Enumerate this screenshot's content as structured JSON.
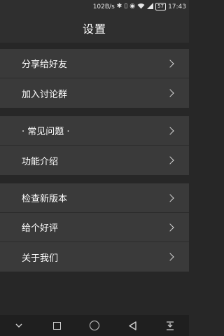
{
  "statusbar": {
    "speed": "102B/s",
    "battery": "57",
    "time": "17:43",
    "icons": [
      "bluetooth-icon",
      "vibrate-icon",
      "eye-icon",
      "wifi-icon",
      "signal-icon"
    ]
  },
  "header": {
    "title": "设置"
  },
  "groups": [
    {
      "items": [
        {
          "label": "分享给好友"
        },
        {
          "label": "加入讨论群"
        }
      ]
    },
    {
      "items": [
        {
          "label": "· 常见问题 ·"
        },
        {
          "label": "功能介绍"
        }
      ]
    },
    {
      "items": [
        {
          "label": "检查新版本"
        },
        {
          "label": "给个好评"
        },
        {
          "label": "关于我们"
        }
      ]
    }
  ],
  "navbar": {
    "buttons": [
      "collapse-icon",
      "recents-icon",
      "home-icon",
      "back-icon",
      "notification-pull-icon"
    ]
  },
  "colors": {
    "background": "#272727",
    "card": "#3a3a3a",
    "header": "#2f2f2f",
    "text": "#ffffff"
  }
}
